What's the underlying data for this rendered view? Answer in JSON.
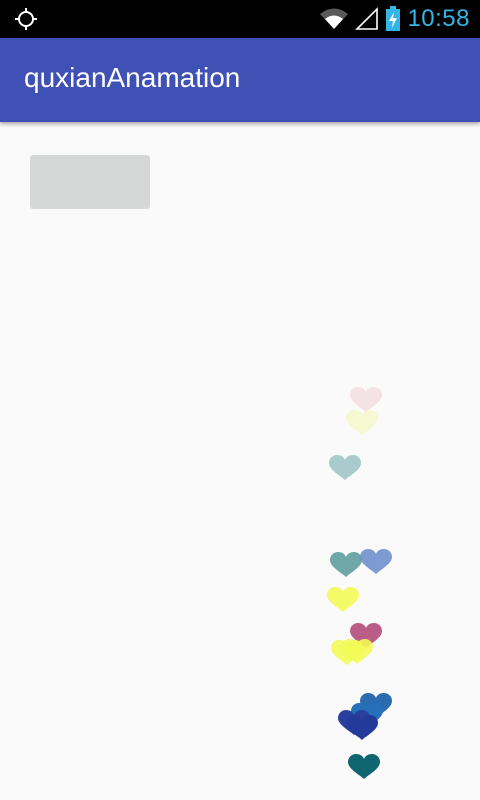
{
  "status_bar": {
    "time": "10:58",
    "icons": [
      "gps-crosshair-icon",
      "wifi-icon",
      "signal-icon",
      "battery-charging-icon"
    ],
    "accent_color": "#33b5e5"
  },
  "app_bar": {
    "title": "quxianAnamation",
    "color": "#3f51b5"
  },
  "content": {
    "button_label": "",
    "button_color": "#d6d7d7"
  },
  "hearts": [
    {
      "color": "#f0d3d6",
      "opacity": 0.6
    },
    {
      "color": "#f3f6b8",
      "opacity": 0.6
    },
    {
      "color": "#86b6b8",
      "opacity": 0.7
    },
    {
      "color": "#5f9e9d",
      "opacity": 0.9
    },
    {
      "color": "#6f90cc",
      "opacity": 0.9
    },
    {
      "color": "#f2fb55",
      "opacity": 0.9
    },
    {
      "color": "#b24d7c",
      "opacity": 0.9
    },
    {
      "color": "#f2fb55",
      "opacity": 0.9
    },
    {
      "color": "#f2fb55",
      "opacity": 0.9
    },
    {
      "color": "#2b6cb0",
      "opacity": 1.0
    },
    {
      "color": "#2570b8",
      "opacity": 1.0
    },
    {
      "color": "#2a3f9e",
      "opacity": 1.0
    },
    {
      "color": "#233a9a",
      "opacity": 1.0
    },
    {
      "color": "#0f6670",
      "opacity": 1.0
    }
  ]
}
